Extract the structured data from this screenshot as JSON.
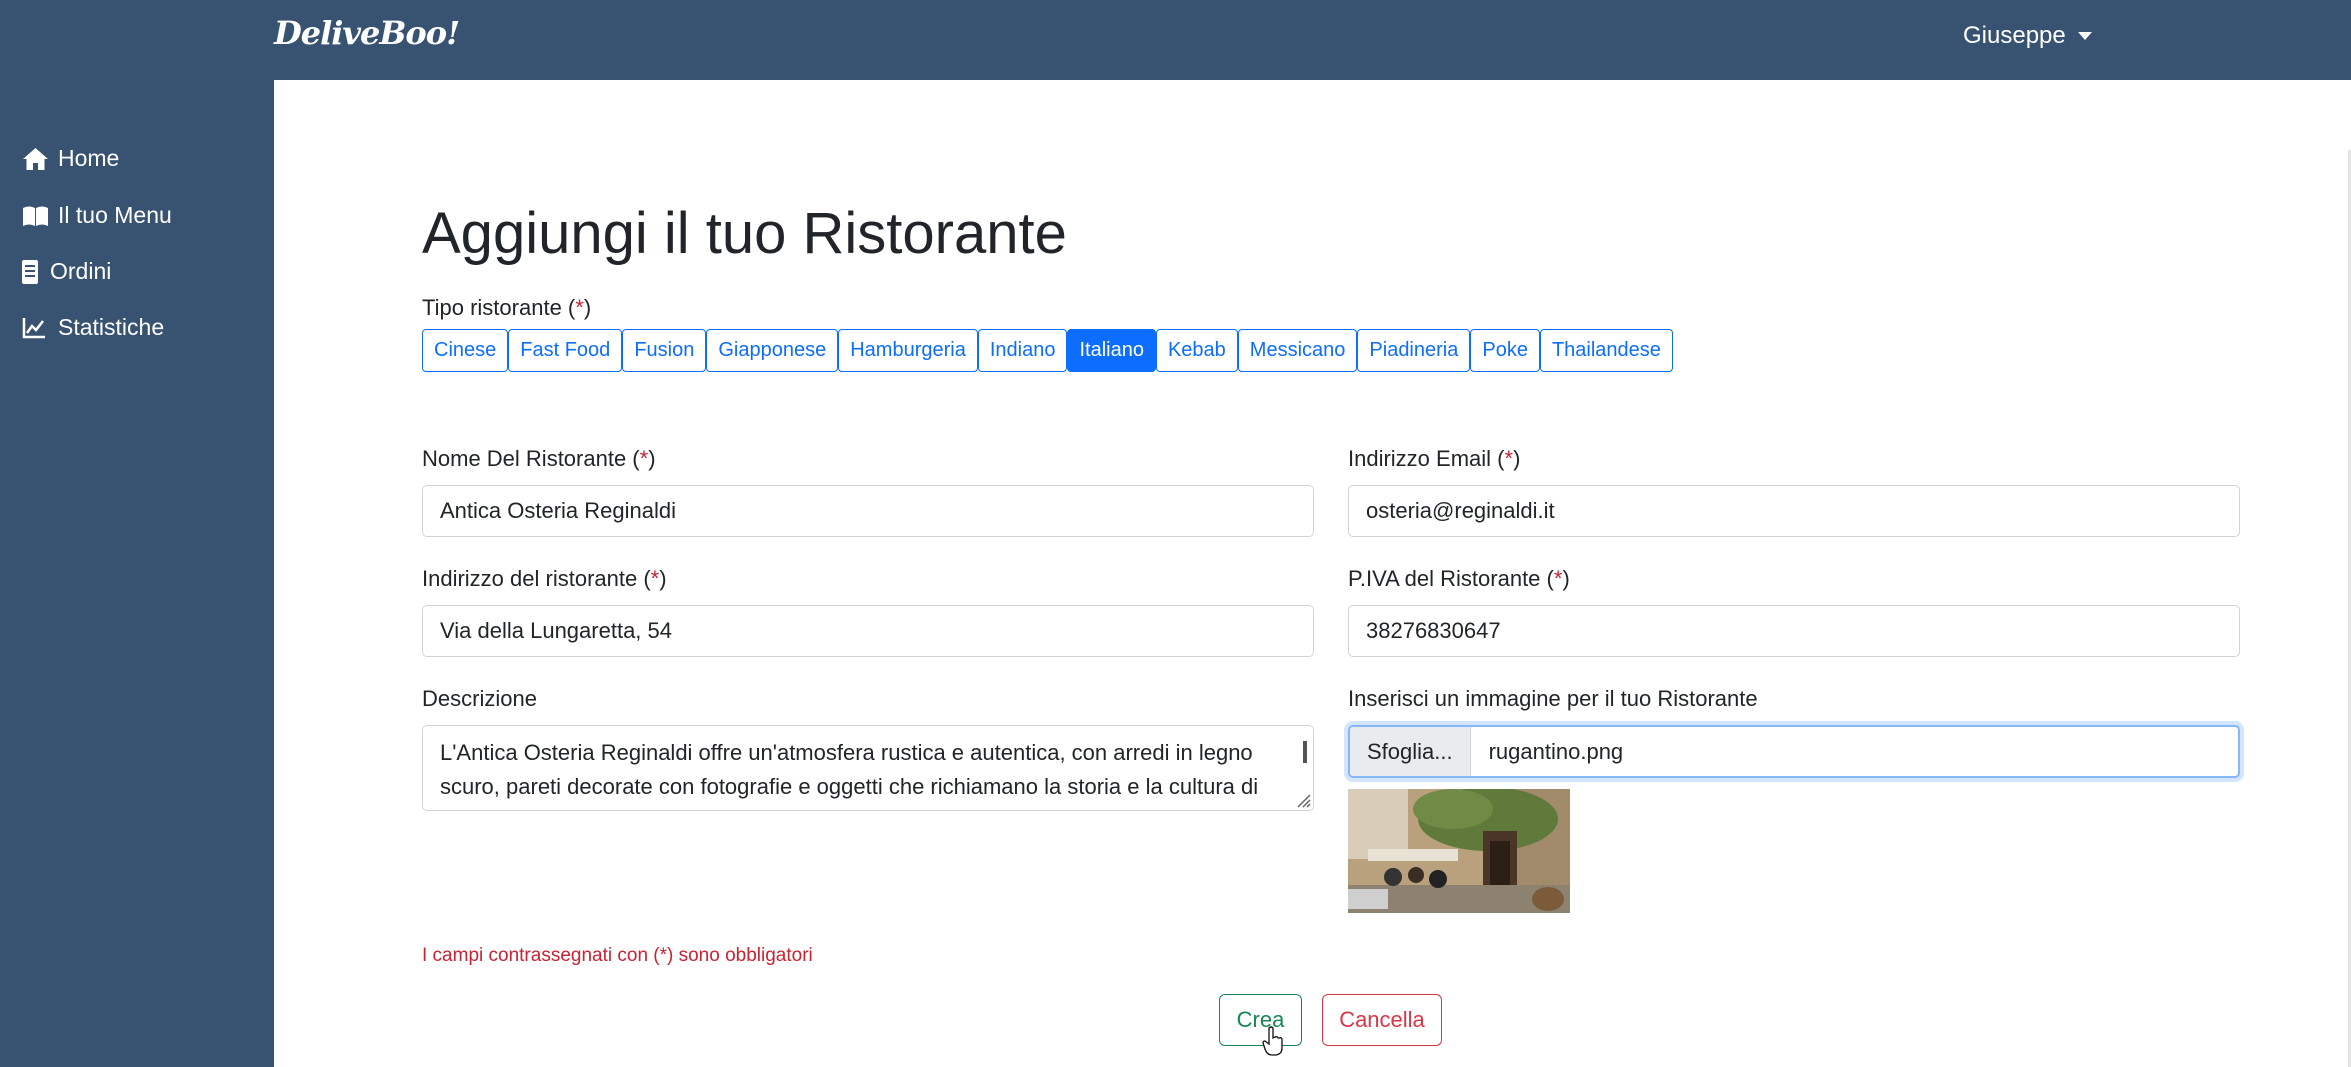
{
  "header": {
    "logo": "DeliveBoo!",
    "user_name": "Giuseppe"
  },
  "sidebar": {
    "items": [
      {
        "label": "Home",
        "icon": "home-icon"
      },
      {
        "label": "Il tuo Menu",
        "icon": "book-icon"
      },
      {
        "label": "Ordini",
        "icon": "receipt-icon"
      },
      {
        "label": "Statistiche",
        "icon": "chart-line-icon"
      }
    ]
  },
  "form": {
    "title": "Aggiungi il tuo Ristorante",
    "required_mark": "*",
    "type_label": "Tipo ristorante",
    "types": [
      "Cinese",
      "Fast Food",
      "Fusion",
      "Giapponese",
      "Hamburgeria",
      "Indiano",
      "Italiano",
      "Kebab",
      "Messicano",
      "Piadineria",
      "Poke",
      "Thailandese"
    ],
    "selected_type": "Italiano",
    "name_label": "Nome Del Ristorante",
    "name_value": "Antica Osteria Reginaldi",
    "email_label": "Indirizzo Email",
    "email_value": "osteria@reginaldi.it",
    "address_label": "Indirizzo del ristorante",
    "address_value": "Via della Lungaretta, 54",
    "vat_label": "P.IVA del Ristorante",
    "vat_value": "38276830647",
    "description_label": "Descrizione",
    "description_value": "L'Antica Osteria Reginaldi offre un'atmosfera rustica e autentica, con arredi in legno scuro, pareti decorate con fotografie e oggetti che richiamano la storia e la cultura di",
    "image_label": "Inserisci un immagine per il tuo Ristorante",
    "browse_label": "Sfoglia...",
    "file_name": "rugantino.png",
    "required_note": "I campi contrassegnati con (*) sono obbligatori",
    "create_label": "Crea",
    "cancel_label": "Cancella"
  },
  "colors": {
    "navbar": "#385272",
    "primary": "#0d6efd",
    "success": "#198754",
    "danger": "#dc3545"
  }
}
